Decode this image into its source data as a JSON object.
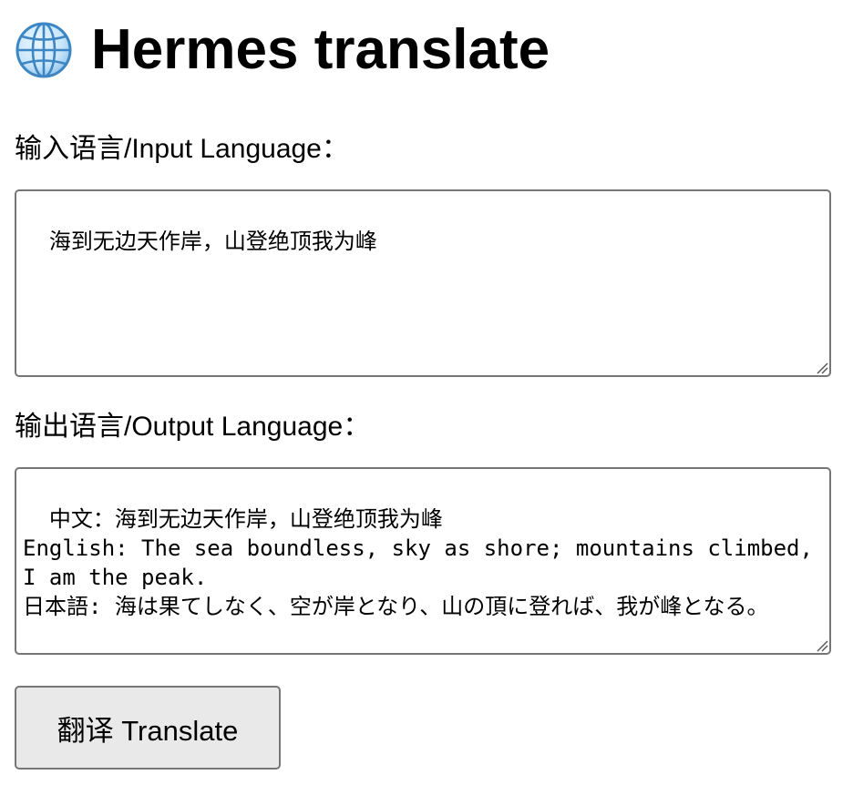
{
  "header": {
    "icon": "globe-icon",
    "title": "Hermes translate"
  },
  "input": {
    "label": "输入语言/Input Language：",
    "value": "海到无边天作岸，山登绝顶我为峰"
  },
  "output": {
    "label": "输出语言/Output Language：",
    "value": "中文：海到无边天作岸，山登绝顶我为峰\nEnglish: The sea boundless, sky as shore; mountains climbed, I am the peak.\n日本語: 海は果てしなく、空が岸となり、山の頂に登れば、我が峰となる。"
  },
  "translate_button": {
    "label": "翻译 Translate"
  },
  "colors": {
    "border": "#767676",
    "button_bg": "#e9e9e9",
    "globe_blue": "#4a90c8"
  }
}
